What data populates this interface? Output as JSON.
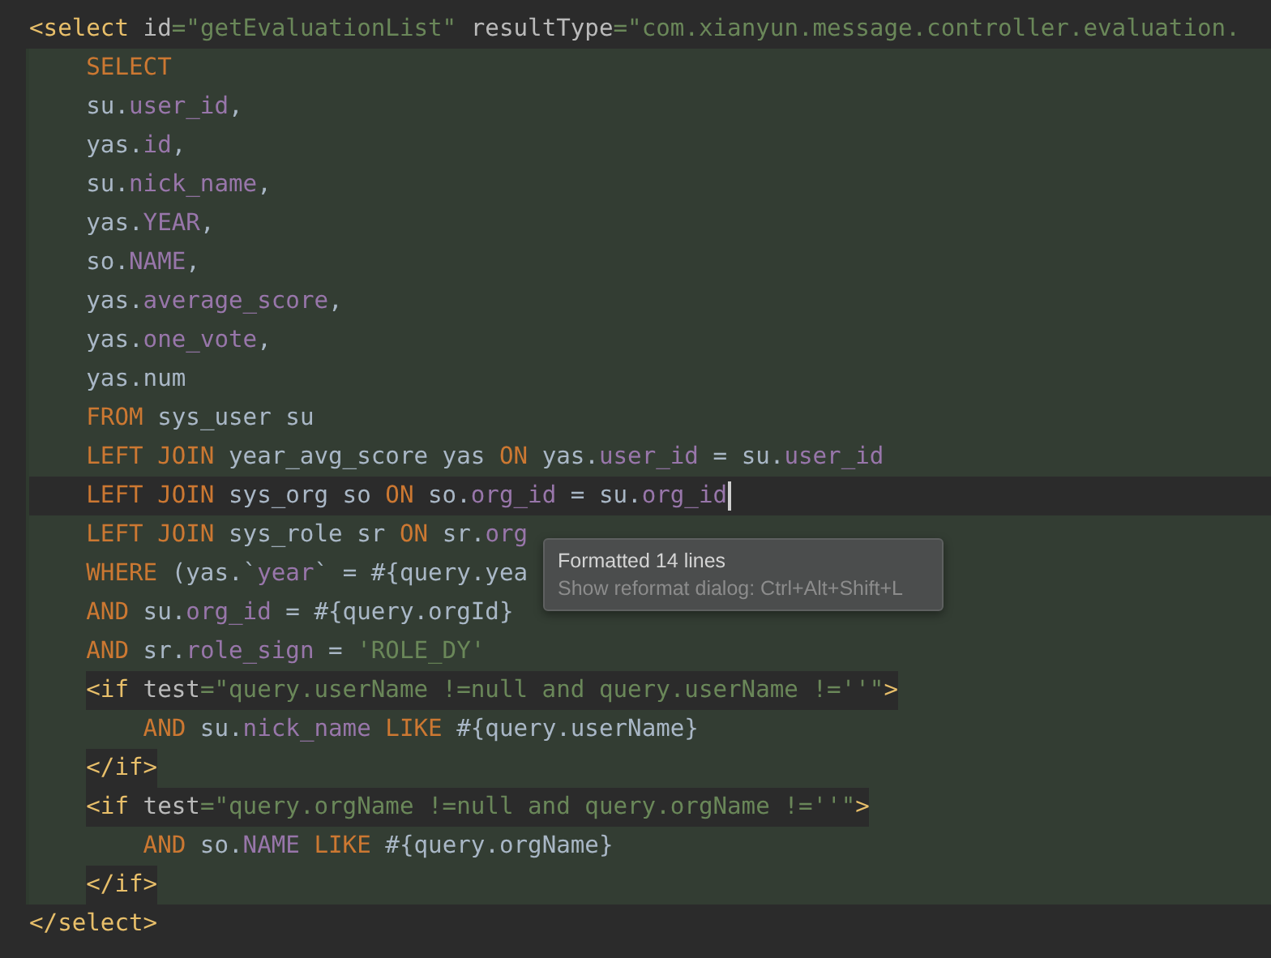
{
  "lines": [
    {
      "current": false,
      "tokens": [
        {
          "kind": "tag",
          "text": "<select"
        },
        {
          "kind": "attr",
          "text": " id"
        },
        {
          "kind": "str",
          "text": "=\"getEvaluationList\""
        },
        {
          "kind": "attr",
          "text": " resultType"
        },
        {
          "kind": "str",
          "text": "=\"com.xianyun.message.controller.evaluation."
        }
      ],
      "children": [
        {
          "current": false,
          "tokens": [
            {
              "kind": "kw",
              "text": "SELECT"
            }
          ]
        },
        {
          "current": false,
          "tokens": [
            {
              "kind": "plain",
              "text": "su."
            },
            {
              "kind": "field",
              "text": "user_id"
            },
            {
              "kind": "plain",
              "text": ","
            }
          ]
        },
        {
          "current": false,
          "tokens": [
            {
              "kind": "plain",
              "text": "yas."
            },
            {
              "kind": "field",
              "text": "id"
            },
            {
              "kind": "plain",
              "text": ","
            }
          ]
        },
        {
          "current": false,
          "tokens": [
            {
              "kind": "plain",
              "text": "su."
            },
            {
              "kind": "field",
              "text": "nick_name"
            },
            {
              "kind": "plain",
              "text": ","
            }
          ]
        },
        {
          "current": false,
          "tokens": [
            {
              "kind": "plain",
              "text": "yas."
            },
            {
              "kind": "field",
              "text": "YEAR"
            },
            {
              "kind": "plain",
              "text": ","
            }
          ]
        },
        {
          "current": false,
          "tokens": [
            {
              "kind": "plain",
              "text": "so."
            },
            {
              "kind": "field",
              "text": "NAME"
            },
            {
              "kind": "plain",
              "text": ","
            }
          ]
        },
        {
          "current": false,
          "tokens": [
            {
              "kind": "plain",
              "text": "yas."
            },
            {
              "kind": "field",
              "text": "average_score"
            },
            {
              "kind": "plain",
              "text": ","
            }
          ]
        },
        {
          "current": false,
          "tokens": [
            {
              "kind": "plain",
              "text": "yas."
            },
            {
              "kind": "field",
              "text": "one_vote"
            },
            {
              "kind": "plain",
              "text": ","
            }
          ]
        },
        {
          "current": false,
          "tokens": [
            {
              "kind": "plain",
              "text": "yas.num"
            }
          ]
        },
        {
          "current": false,
          "tokens": [
            {
              "kind": "kw",
              "text": "FROM"
            },
            {
              "kind": "plain",
              "text": " sys_user su"
            }
          ]
        },
        {
          "current": false,
          "tokens": [
            {
              "kind": "kw",
              "text": "LEFT JOIN"
            },
            {
              "kind": "plain",
              "text": " year_avg_score yas "
            },
            {
              "kind": "kw",
              "text": "ON"
            },
            {
              "kind": "plain",
              "text": " yas."
            },
            {
              "kind": "field",
              "text": "user_id"
            },
            {
              "kind": "plain",
              "text": " = su."
            },
            {
              "kind": "field",
              "text": "user_id"
            }
          ]
        },
        {
          "current": true,
          "tokens": [
            {
              "kind": "kw",
              "text": "LEFT JOIN"
            },
            {
              "kind": "plain",
              "text": " sys_org so "
            },
            {
              "kind": "kw",
              "text": "ON"
            },
            {
              "kind": "plain",
              "text": " so."
            },
            {
              "kind": "field",
              "text": "org_id"
            },
            {
              "kind": "plain",
              "text": " = su."
            },
            {
              "kind": "field",
              "text": "org_id"
            }
          ]
        },
        {
          "current": false,
          "tokens": [
            {
              "kind": "kw",
              "text": "LEFT JOIN"
            },
            {
              "kind": "plain",
              "text": " sys_role sr "
            },
            {
              "kind": "kw",
              "text": "ON"
            },
            {
              "kind": "plain",
              "text": " sr."
            },
            {
              "kind": "field",
              "text": "org"
            }
          ]
        },
        {
          "current": false,
          "tokens": [
            {
              "kind": "kw",
              "text": "WHERE"
            },
            {
              "kind": "plain",
              "text": " (yas.`"
            },
            {
              "kind": "field",
              "text": "year"
            },
            {
              "kind": "plain",
              "text": "` = #{query.yea"
            }
          ]
        },
        {
          "current": false,
          "tokens": [
            {
              "kind": "kw",
              "text": "AND"
            },
            {
              "kind": "plain",
              "text": " su."
            },
            {
              "kind": "field",
              "text": "org_id"
            },
            {
              "kind": "plain",
              "text": " = #{query.orgId}"
            }
          ]
        },
        {
          "current": false,
          "tokens": [
            {
              "kind": "kw",
              "text": "AND"
            },
            {
              "kind": "plain",
              "text": " sr."
            },
            {
              "kind": "field",
              "text": "role_sign"
            },
            {
              "kind": "plain",
              "text": " = "
            },
            {
              "kind": "str",
              "text": "'ROLE_DY'"
            }
          ]
        },
        {
          "current": false,
          "tokens": [
            {
              "kind": "tag",
              "text": "<if"
            },
            {
              "kind": "attr",
              "text": " test"
            },
            {
              "kind": "str",
              "text": "=\"query.userName !=null and query.userName !=''\""
            },
            {
              "kind": "tag",
              "text": ">"
            }
          ],
          "children": [
            {
              "current": false,
              "tokens": [
                {
                  "kind": "kw",
                  "text": "AND"
                },
                {
                  "kind": "plain",
                  "text": " su."
                },
                {
                  "kind": "field",
                  "text": "nick_name"
                },
                {
                  "kind": "kw",
                  "text": " LIKE"
                },
                {
                  "kind": "plain",
                  "text": " #{query.userName}"
                }
              ]
            }
          ]
        },
        {
          "current": false,
          "tokens": [
            {
              "kind": "tag",
              "text": "</if>"
            }
          ]
        },
        {
          "current": false,
          "tokens": [
            {
              "kind": "tag",
              "text": "<if"
            },
            {
              "kind": "attr",
              "text": " test"
            },
            {
              "kind": "str",
              "text": "=\"query.orgName !=null and query.orgName !=''\""
            },
            {
              "kind": "tag",
              "text": ">"
            }
          ],
          "children": [
            {
              "current": false,
              "tokens": [
                {
                  "kind": "kw",
                  "text": "AND"
                },
                {
                  "kind": "plain",
                  "text": " so."
                },
                {
                  "kind": "field",
                  "text": "NAME"
                },
                {
                  "kind": "kw",
                  "text": " LIKE"
                },
                {
                  "kind": "plain",
                  "text": " #{query.orgName}"
                }
              ]
            }
          ]
        },
        {
          "current": false,
          "tokens": [
            {
              "kind": "tag",
              "text": "</if>"
            }
          ]
        }
      ]
    },
    {
      "current": false,
      "tokens": [
        {
          "kind": "tag",
          "text": "</select>"
        }
      ]
    }
  ],
  "tooltip": {
    "title": "Formatted 14 lines",
    "hint": "Show reformat dialog: Ctrl+Alt+Shift+L"
  }
}
